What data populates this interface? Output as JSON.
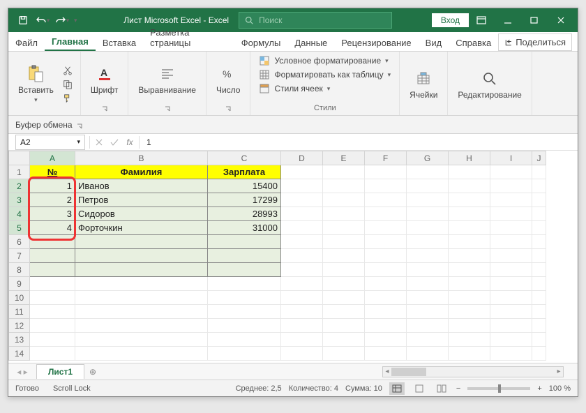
{
  "title": "Лист Microsoft Excel  -  Excel",
  "search_placeholder": "Поиск",
  "login": "Вход",
  "tabs": {
    "file": "Файл",
    "home": "Главная",
    "insert": "Вставка",
    "layout": "Разметка страницы",
    "formulas": "Формулы",
    "data": "Данные",
    "review": "Рецензирование",
    "view": "Вид",
    "help": "Справка"
  },
  "share": "Поделиться",
  "ribbon": {
    "paste": "Вставить",
    "font": "Шрифт",
    "align": "Выравнивание",
    "number": "Число",
    "cond": "Условное форматирование",
    "fmt_table": "Форматировать как таблицу",
    "styles_cells": "Стили ячеек",
    "styles": "Стили",
    "cells": "Ячейки",
    "edit": "Редактирование",
    "clipboard": "Буфер обмена"
  },
  "namebox": "A2",
  "fval": "1",
  "columns": [
    "A",
    "B",
    "C",
    "D",
    "E",
    "F",
    "G",
    "H",
    "I",
    "J"
  ],
  "headers": {
    "a": "№",
    "b": "Фамилия",
    "c": "Зарплата"
  },
  "rows": [
    {
      "n": "1",
      "name": "Иванов",
      "sal": "15400"
    },
    {
      "n": "2",
      "name": "Петров",
      "sal": "17299"
    },
    {
      "n": "3",
      "name": "Сидоров",
      "sal": "28993"
    },
    {
      "n": "4",
      "name": "Форточкин",
      "sal": "31000"
    }
  ],
  "sheet": "Лист1",
  "status": {
    "ready": "Готово",
    "scroll": "Scroll Lock",
    "avg": "Среднее: 2,5",
    "count": "Количество: 4",
    "sum": "Сумма: 10",
    "zoom": "100 %"
  }
}
